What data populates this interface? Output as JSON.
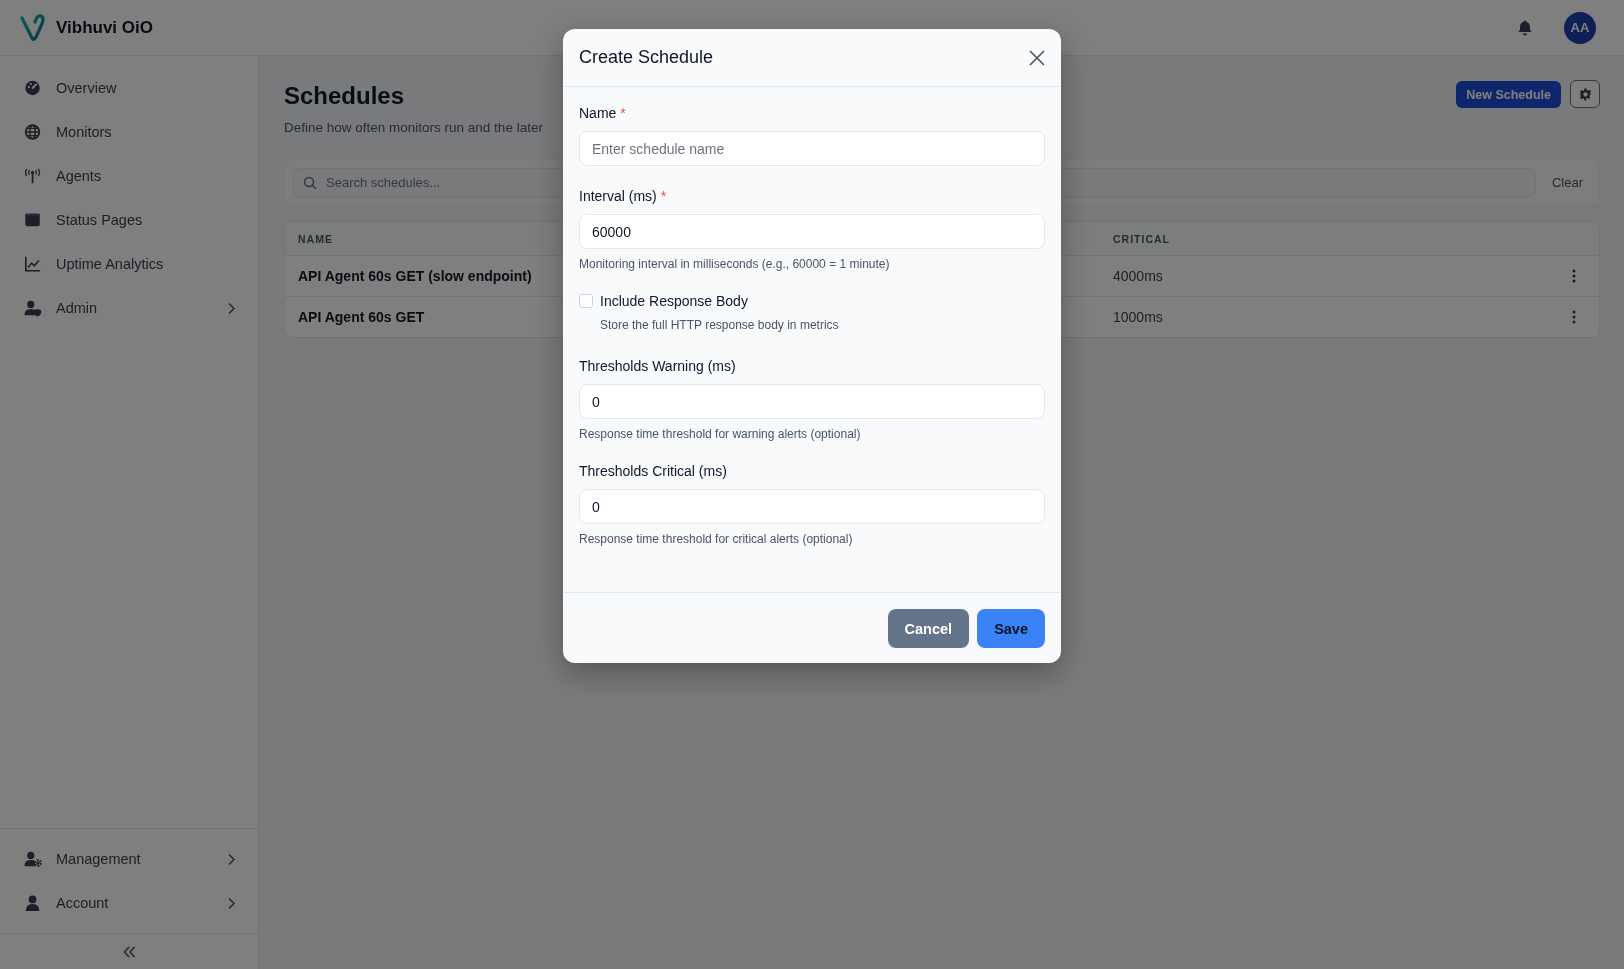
{
  "header": {
    "brand": "Vibhuvi OiO",
    "avatar": "AA"
  },
  "sidebar": {
    "items": [
      {
        "label": "Overview",
        "selected": false,
        "has_submenu": false
      },
      {
        "label": "Monitors",
        "selected": false,
        "has_submenu": false
      },
      {
        "label": "Agents",
        "selected": false,
        "has_submenu": false
      },
      {
        "label": "Status Pages",
        "selected": false,
        "has_submenu": false
      },
      {
        "label": "Uptime Analytics",
        "selected": false,
        "has_submenu": false
      },
      {
        "label": "Admin",
        "selected": false,
        "has_submenu": true
      }
    ],
    "bottom_items": [
      {
        "label": "Management",
        "selected": false,
        "has_submenu": true
      },
      {
        "label": "Account",
        "selected": false,
        "has_submenu": true
      }
    ]
  },
  "page": {
    "title": "Schedules",
    "subtitle": "Define how often monitors run and the later",
    "primary_button": "New Schedule",
    "search": {
      "placeholder": "Search schedules...",
      "clear": "Clear"
    },
    "table": {
      "columns": [
        "NAME",
        "CRITICAL"
      ],
      "rows": [
        {
          "name": "API Agent 60s GET (slow endpoint)",
          "critical": "4000ms"
        },
        {
          "name": "API Agent 60s GET",
          "critical": "1000ms"
        }
      ]
    }
  },
  "modal": {
    "title": "Create Schedule",
    "fields": [
      {
        "kind": "input",
        "label": "Name",
        "marker": "*",
        "placeholder": "Enter schedule name"
      },
      {
        "kind": "input",
        "label": "Interval (ms)",
        "marker": "*",
        "value": "60000",
        "hint": "Monitoring interval in milliseconds (e.g., 60000 = 1 minute)"
      },
      {
        "kind": "checkbox",
        "label": "Include Response Body",
        "checked": false,
        "hint": "Store the full HTTP response body in metrics"
      },
      {
        "kind": "input",
        "label": "Thresholds Warning (ms)",
        "value": "0",
        "hint": "Response time threshold for warning alerts (optional)"
      },
      {
        "kind": "input",
        "label": "Thresholds Critical (ms)",
        "value": "0",
        "hint": "Response time threshold for critical alerts (optional)"
      }
    ],
    "buttons": [
      {
        "label": "Cancel",
        "kind": "secondary"
      },
      {
        "label": "Save",
        "kind": "primary"
      }
    ]
  }
}
